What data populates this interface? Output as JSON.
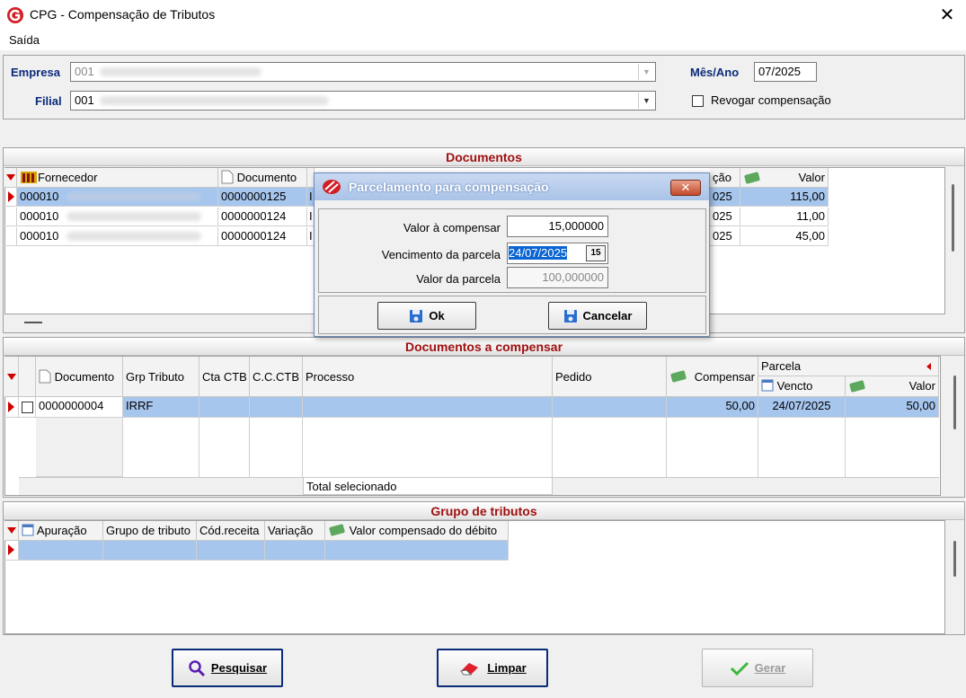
{
  "window": {
    "title": "CPG - Compensação de Tributos",
    "close_glyph": "✕"
  },
  "menu": {
    "saida": "Saída"
  },
  "filters": {
    "empresa_label": "Empresa",
    "empresa_value": "001",
    "filial_label": "Filial",
    "filial_value": "001",
    "mes_ano_label": "Mês/Ano",
    "mes_ano_value": "07/2025",
    "revogar_label": "Revogar compensação"
  },
  "documentos": {
    "title": "Documentos",
    "headers": [
      "Fornecedor",
      "Documento",
      "ção",
      "Valor"
    ],
    "rows": [
      {
        "fornecedor": "000010",
        "documento": "0000000125",
        "prefix": "I",
        "cao": "025",
        "valor": "115,00"
      },
      {
        "fornecedor": "000010",
        "documento": "0000000124",
        "prefix": "I",
        "cao": "025",
        "valor": "11,00"
      },
      {
        "fornecedor": "000010",
        "documento": "0000000124",
        "prefix": "I",
        "cao": "025",
        "valor": "45,00"
      }
    ]
  },
  "dialog": {
    "title": "Parcelamento para compensação",
    "close_glyph": "✕",
    "valor_compensar_label": "Valor à compensar",
    "valor_compensar_value": "15,000000",
    "vencimento_label": "Vencimento da parcela",
    "vencimento_value": "24/07/2025",
    "calendar_glyph": "15",
    "valor_parcela_label": "Valor da parcela",
    "valor_parcela_value": "100,000000",
    "ok_label": "Ok",
    "cancelar_label": "Cancelar"
  },
  "compensar": {
    "title": "Documentos a compensar",
    "headers": {
      "documento": "Documento",
      "grp_tributo": "Grp Tributo",
      "cta_ctb": "Cta CTB",
      "cc_ctb": "C.C.CTB",
      "processo": "Processo",
      "pedido": "Pedido",
      "compensar": "Compensar",
      "parcela": "Parcela",
      "vencto": "Vencto",
      "valor": "Valor"
    },
    "row": {
      "documento": "0000000004",
      "grp_tributo": "IRRF",
      "compensar": "50,00",
      "vencto": "24/07/2025",
      "valor": "50,00"
    },
    "total_label": "Total selecionado"
  },
  "grupo": {
    "title": "Grupo de tributos",
    "headers": [
      "Apuração",
      "Grupo de tributo",
      "Cód.receita",
      "Variação",
      "Valor compensado do débito"
    ]
  },
  "buttons": {
    "pesquisar": "Pesquisar",
    "limpar": "Limpar",
    "gerar": "Gerar"
  },
  "colors": {
    "accent": "#a01010",
    "selection": "#a6c6ee",
    "label": "#0a2a7a"
  }
}
